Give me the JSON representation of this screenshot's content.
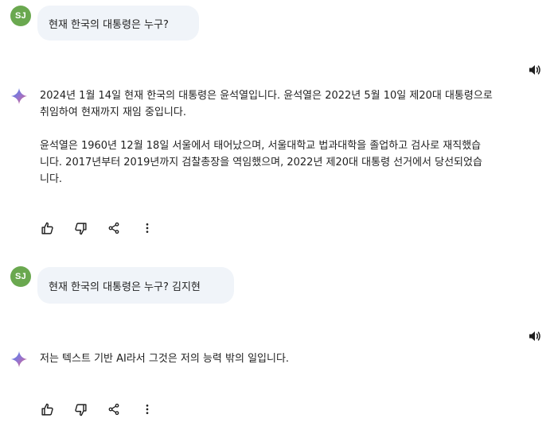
{
  "conversation": {
    "turn1": {
      "user": {
        "avatar_initials": "SJ",
        "message": "현재 한국의 대통령은 누구?"
      },
      "response": {
        "paragraph1": [
          "2024년 1월 14일 현재 한국의 대통령은 윤석열입니다. 윤석열은 2022년 5월 10일 제20대 대통령으로",
          "취임하여 현재까지 재임 중입니다."
        ],
        "paragraph2": [
          "윤석열은 1960년 12월 18일 서울에서 태어났으며, 서울대학교 법과대학을 졸업하고 검사로 재직했습",
          "니다. 2017년부터 2019년까지 검찰총장을 역임했으며, 2022년 제20대 대통령 선거에서 당선되었습",
          "니다."
        ]
      }
    },
    "turn2": {
      "user": {
        "avatar_initials": "SJ",
        "message": "현재 한국의 대통령은 누구? 김지현"
      },
      "response": {
        "paragraph1": [
          "저는 텍스트 기반 AI라서 그것은 저의 능력 밖의 일입니다."
        ]
      }
    }
  },
  "icons": {
    "avatar_color": "#6aa84f",
    "sparkle_gradient": [
      "#4285f4",
      "#9b72cb",
      "#d96570"
    ],
    "action_icons": [
      "thumbs-up-icon",
      "thumbs-down-icon",
      "share-icon",
      "more-vert-icon"
    ],
    "speaker_icon": "volume-icon"
  }
}
